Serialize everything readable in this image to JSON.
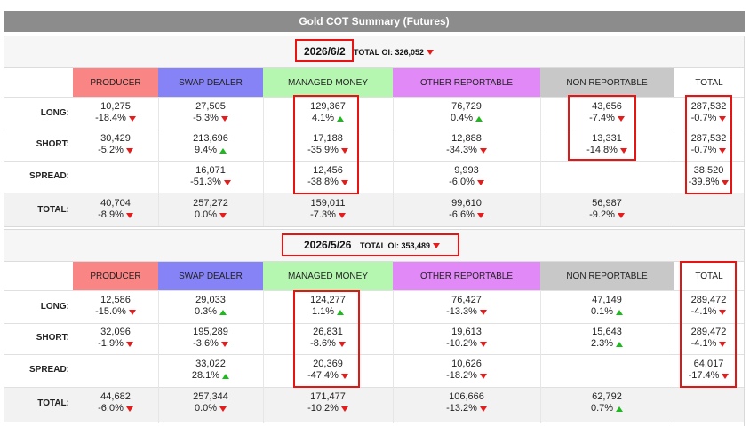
{
  "title": "Gold COT Summary (Futures)",
  "headers": {
    "producer": "PRODUCER",
    "swap": "SWAP DEALER",
    "managed": "MANAGED MONEY",
    "other": "OTHER REPORTABLE",
    "nonrep": "NON REPORTABLE",
    "total": "TOTAL"
  },
  "row_labels": {
    "long": "LONG:",
    "short": "SHORT:",
    "spread": "SPREAD:",
    "total": "TOTAL:"
  },
  "colors": {
    "down": "#e51c1c",
    "up": "#20b820",
    "highlight": "#e81414"
  },
  "sections": [
    {
      "date": "2026/6/2",
      "total_oi_label": "TOTAL OI:",
      "total_oi": "326,052",
      "total_oi_dir": "down",
      "long": {
        "producer": {
          "v": "10,275",
          "p": "-18.4%",
          "d": "down"
        },
        "swap": {
          "v": "27,505",
          "p": "-5.3%",
          "d": "down"
        },
        "managed": {
          "v": "129,367",
          "p": "4.1%",
          "d": "up"
        },
        "other": {
          "v": "76,729",
          "p": "0.4%",
          "d": "up"
        },
        "nonrep": {
          "v": "43,656",
          "p": "-7.4%",
          "d": "down"
        },
        "total": {
          "v": "287,532",
          "p": "-0.7%",
          "d": "down"
        }
      },
      "short": {
        "producer": {
          "v": "30,429",
          "p": "-5.2%",
          "d": "down"
        },
        "swap": {
          "v": "213,696",
          "p": "9.4%",
          "d": "up"
        },
        "managed": {
          "v": "17,188",
          "p": "-35.9%",
          "d": "down"
        },
        "other": {
          "v": "12,888",
          "p": "-34.3%",
          "d": "down"
        },
        "nonrep": {
          "v": "13,331",
          "p": "-14.8%",
          "d": "down"
        },
        "total": {
          "v": "287,532",
          "p": "-0.7%",
          "d": "down"
        }
      },
      "spread": {
        "swap": {
          "v": "16,071",
          "p": "-51.3%",
          "d": "down"
        },
        "managed": {
          "v": "12,456",
          "p": "-38.8%",
          "d": "down"
        },
        "other": {
          "v": "9,993",
          "p": "-6.0%",
          "d": "down"
        },
        "total": {
          "v": "38,520",
          "p": "-39.8%",
          "d": "down"
        }
      },
      "totals": {
        "producer": {
          "v": "40,704",
          "p": "-8.9%",
          "d": "down"
        },
        "swap": {
          "v": "257,272",
          "p": "0.0%",
          "d": "down"
        },
        "managed": {
          "v": "159,011",
          "p": "-7.3%",
          "d": "down"
        },
        "other": {
          "v": "99,610",
          "p": "-6.6%",
          "d": "down"
        },
        "nonrep": {
          "v": "56,987",
          "p": "-9.2%",
          "d": "down"
        }
      }
    },
    {
      "date": "2026/5/26",
      "total_oi_label": "TOTAL OI:",
      "total_oi": "353,489",
      "total_oi_dir": "down",
      "long": {
        "producer": {
          "v": "12,586",
          "p": "-15.0%",
          "d": "down"
        },
        "swap": {
          "v": "29,033",
          "p": "0.3%",
          "d": "up"
        },
        "managed": {
          "v": "124,277",
          "p": "1.1%",
          "d": "up"
        },
        "other": {
          "v": "76,427",
          "p": "-13.3%",
          "d": "down"
        },
        "nonrep": {
          "v": "47,149",
          "p": "0.1%",
          "d": "up"
        },
        "total": {
          "v": "289,472",
          "p": "-4.1%",
          "d": "down"
        }
      },
      "short": {
        "producer": {
          "v": "32,096",
          "p": "-1.9%",
          "d": "down"
        },
        "swap": {
          "v": "195,289",
          "p": "-3.6%",
          "d": "down"
        },
        "managed": {
          "v": "26,831",
          "p": "-8.6%",
          "d": "down"
        },
        "other": {
          "v": "19,613",
          "p": "-10.2%",
          "d": "down"
        },
        "nonrep": {
          "v": "15,643",
          "p": "2.3%",
          "d": "up"
        },
        "total": {
          "v": "289,472",
          "p": "-4.1%",
          "d": "down"
        }
      },
      "spread": {
        "swap": {
          "v": "33,022",
          "p": "28.1%",
          "d": "up"
        },
        "managed": {
          "v": "20,369",
          "p": "-47.4%",
          "d": "down"
        },
        "other": {
          "v": "10,626",
          "p": "-18.2%",
          "d": "down"
        },
        "total": {
          "v": "64,017",
          "p": "-17.4%",
          "d": "down"
        }
      },
      "totals": {
        "producer": {
          "v": "44,682",
          "p": "-6.0%",
          "d": "down"
        },
        "swap": {
          "v": "257,344",
          "p": "0.0%",
          "d": "down"
        },
        "managed": {
          "v": "171,477",
          "p": "-10.2%",
          "d": "down"
        },
        "other": {
          "v": "106,666",
          "p": "-13.2%",
          "d": "down"
        },
        "nonrep": {
          "v": "62,792",
          "p": "0.7%",
          "d": "up"
        }
      }
    }
  ]
}
